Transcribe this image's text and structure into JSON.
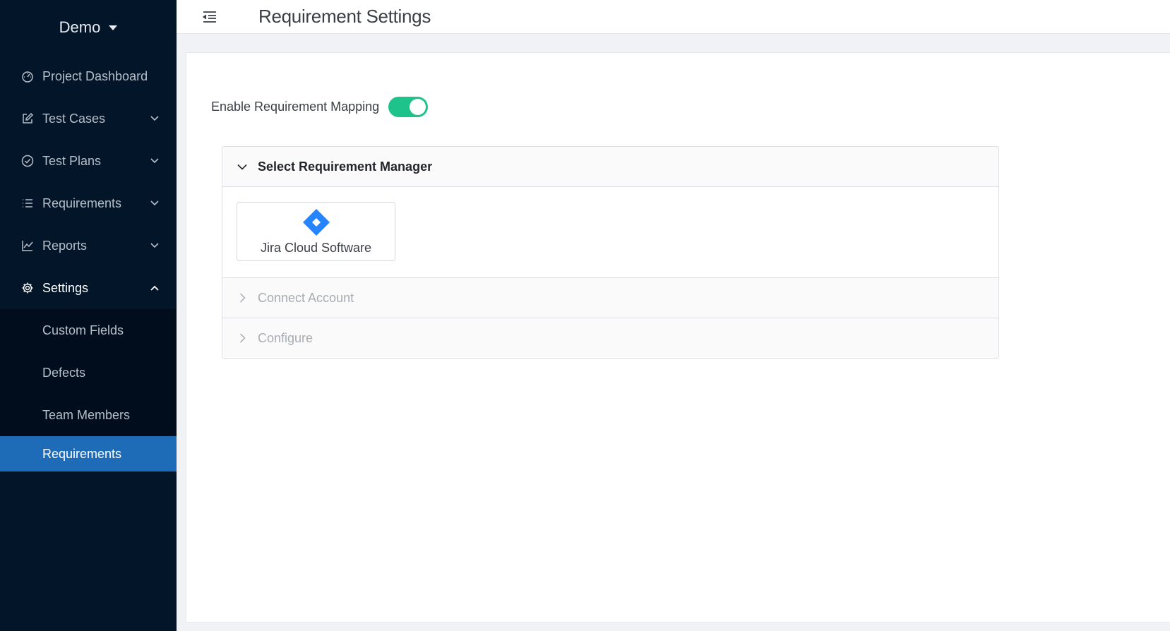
{
  "project": {
    "name": "Demo"
  },
  "sidebar": {
    "items": [
      {
        "label": "Project Dashboard",
        "icon": "dashboard-icon",
        "has_children": false
      },
      {
        "label": "Test Cases",
        "icon": "edit-icon",
        "has_children": true
      },
      {
        "label": "Test Plans",
        "icon": "check-circle-icon",
        "has_children": true
      },
      {
        "label": "Requirements",
        "icon": "list-icon",
        "has_children": true
      },
      {
        "label": "Reports",
        "icon": "line-chart-icon",
        "has_children": true
      },
      {
        "label": "Settings",
        "icon": "gear-icon",
        "has_children": true,
        "expanded": true
      }
    ],
    "settings_children": [
      {
        "label": "Custom Fields"
      },
      {
        "label": "Defects"
      },
      {
        "label": "Team Members"
      },
      {
        "label": "Requirements",
        "active": true
      }
    ]
  },
  "header": {
    "title": "Requirement Settings"
  },
  "main": {
    "toggle": {
      "label": "Enable Requirement Mapping",
      "enabled": true
    },
    "accordion": {
      "sections": [
        {
          "title": "Select Requirement Manager",
          "expanded": true,
          "enabled": true
        },
        {
          "title": "Connect Account",
          "expanded": false,
          "enabled": false
        },
        {
          "title": "Configure",
          "expanded": false,
          "enabled": false
        }
      ],
      "tools": [
        {
          "name": "Jira Cloud Software",
          "icon": "jira-logo-icon"
        }
      ]
    }
  },
  "colors": {
    "sidebar_bg": "#031529",
    "submenu_bg": "#010d1c",
    "active_item": "#1e6bb8",
    "toggle_on": "#1ec28b",
    "jira_blue": "#2684ff"
  }
}
